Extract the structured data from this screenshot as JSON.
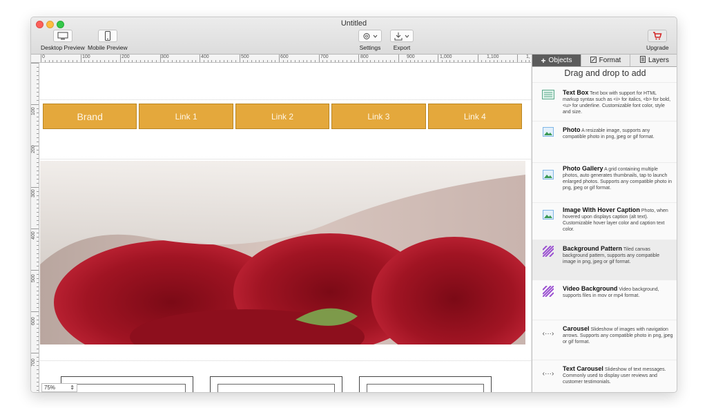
{
  "window": {
    "title": "Untitled"
  },
  "toolbar": {
    "desktop_preview": "Desktop Preview",
    "mobile_preview": "Mobile Preview",
    "settings": "Settings",
    "export": "Export",
    "upgrade": "Upgrade"
  },
  "ruler": {
    "h_labels": [
      "0",
      "100",
      "200",
      "300",
      "400",
      "500",
      "600",
      "700",
      "800",
      "900",
      "1,000",
      "1,100",
      "1,"
    ],
    "v_labels": [
      "100",
      "200",
      "300",
      "400",
      "500",
      "600",
      "700",
      "800"
    ]
  },
  "nav": {
    "brand": "Brand",
    "links": [
      "Link 1",
      "Link 2",
      "Link 3",
      "Link 4"
    ]
  },
  "zoom": {
    "value": "75%"
  },
  "panel": {
    "tabs": {
      "objects": "Objects",
      "format": "Format",
      "layers": "Layers"
    },
    "hint": "Drag and drop to add",
    "items": [
      {
        "title": "Text Box",
        "desc": "Text box with support for HTML markup syntax such as <i> for italics, <b> for bold, <u> for underline. Customizable font color, style and size."
      },
      {
        "title": "Photo",
        "desc": "A resizable image, supports any compatible photo in png, jpeg or gif format."
      },
      {
        "title": "Photo Gallery",
        "desc": "A grid containing multiple photos, auto generates thumbnails, tap to launch enlarged photos. Supports any compatible photo in png, jpeg or gif format."
      },
      {
        "title": "Image With Hover Caption",
        "desc": "Photo, when hovered upon displays caption (alt text). Customizable hover layer color and caption text color."
      },
      {
        "title": "Background Pattern",
        "desc": "Tiled canvas background pattern, supports any compatible image in png, jpeg or gif format."
      },
      {
        "title": "Video Background",
        "desc": "Video background, supports files in mov or mp4 format."
      },
      {
        "title": "Carousel",
        "desc": "Slideshow of images with navigation arrows.  Supports any compatible photo in png, jpeg or gif format."
      },
      {
        "title": "Text Carousel",
        "desc": "Slideshow of text messages.  Commonly used to display user reviews and customer testimonials."
      }
    ]
  },
  "colors": {
    "nav_fill": "#e4a83c",
    "active_tab": "#5b5b5b",
    "pattern_icon": "#9a4fd1",
    "photo_icon": "#7fb6e6"
  }
}
